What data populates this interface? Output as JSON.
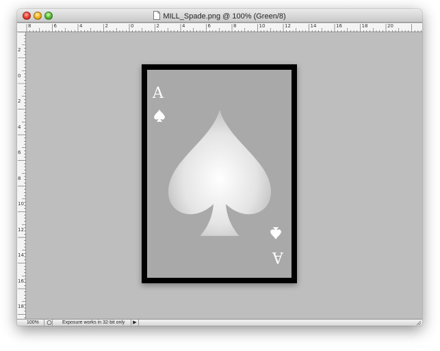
{
  "window": {
    "title": "MILL_Spade.png @ 100% (Green/8)",
    "controls": [
      "close-button",
      "minimize-button",
      "zoom-button"
    ]
  },
  "rulers": {
    "top_labels": [
      "8",
      "6",
      "4",
      "2",
      "0",
      "2",
      "4",
      "6",
      "8",
      "10",
      "12",
      "14",
      "16",
      "18",
      "20"
    ],
    "left_labels": [
      "2",
      "0",
      "2",
      "4",
      "6",
      "8",
      "10",
      "12",
      "14",
      "16",
      "18"
    ]
  },
  "canvas": {
    "background": "#bebebe",
    "card": {
      "rank": "A",
      "suit_icon": "spade-icon",
      "border_color": "#000000",
      "face_color": "#a9a9a9"
    }
  },
  "status": {
    "zoom": "100%",
    "message": "Exposure works in 32-bit only",
    "arrow": "▶"
  }
}
